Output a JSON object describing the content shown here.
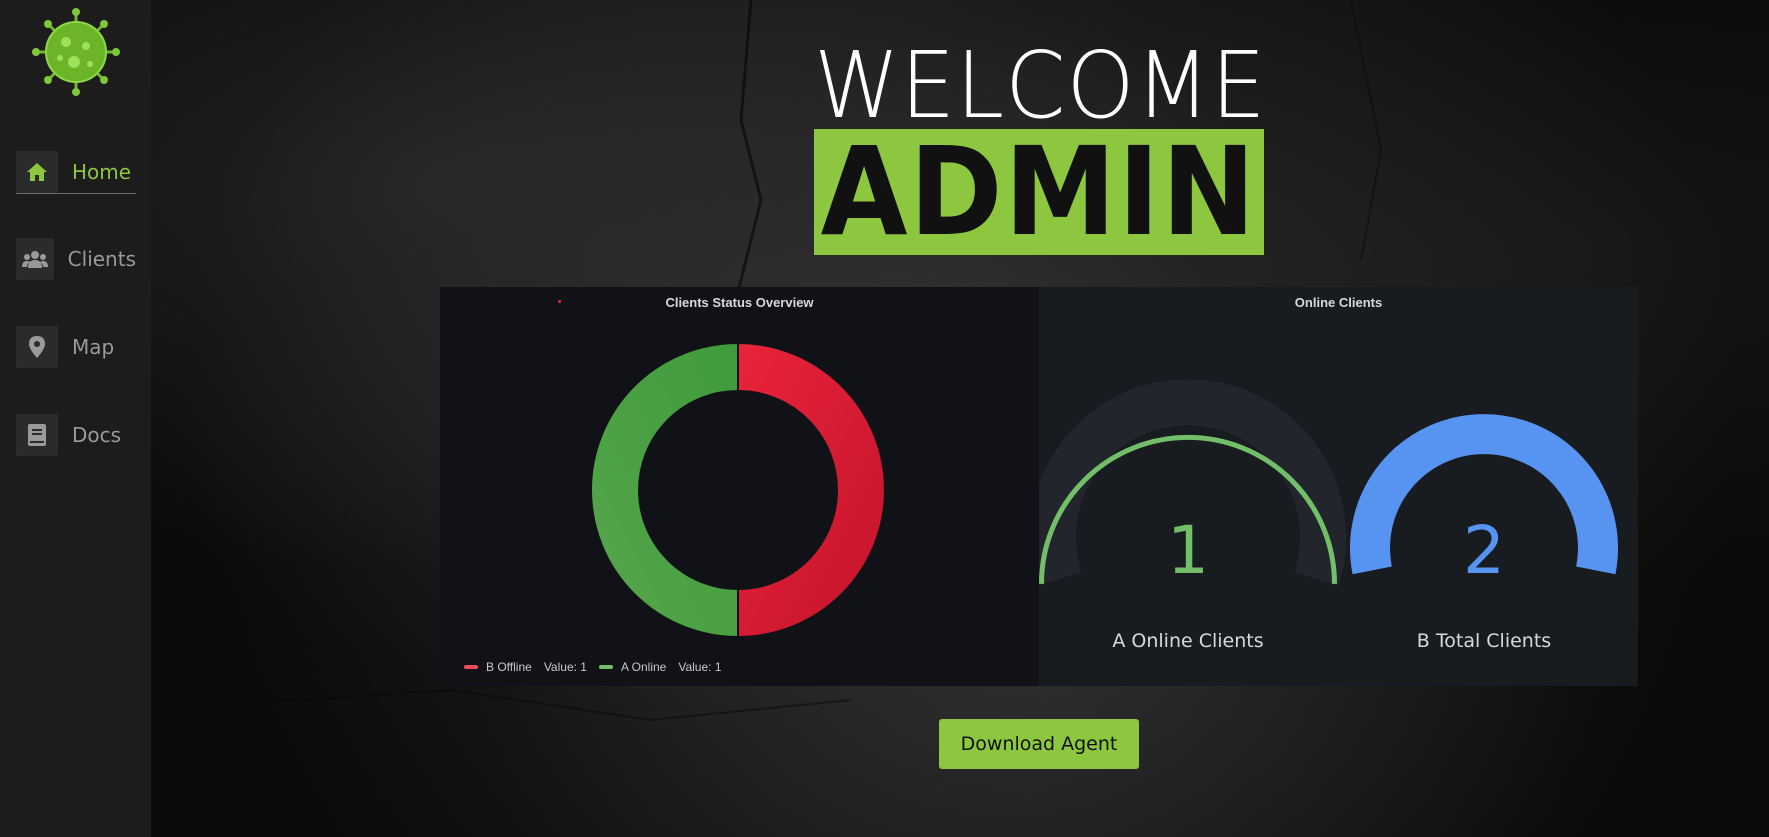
{
  "sidebar": {
    "logo_icon": "virus-icon",
    "items": [
      {
        "label": "Home",
        "icon": "home-icon",
        "active": true
      },
      {
        "label": "Clients",
        "icon": "users-icon",
        "active": false
      },
      {
        "label": "Map",
        "icon": "map-marker-icon",
        "active": false
      },
      {
        "label": "Docs",
        "icon": "book-icon",
        "active": false
      }
    ]
  },
  "header": {
    "welcome": "WELCOME",
    "admin": "ADMIN"
  },
  "status_panel": {
    "title": "Clients Status Overview",
    "chart_data": {
      "type": "pie",
      "title": "Clients Status Overview",
      "categories": [
        "B Offline",
        "A Online"
      ],
      "values": [
        1,
        1
      ],
      "colors": [
        "#e02f44",
        "#56a64b"
      ],
      "legend_placement": "bottom-left"
    },
    "legend": [
      {
        "name": "B Offline",
        "value_text": "Value: 1",
        "color": "#f2495c"
      },
      {
        "name": "A Online",
        "value_text": "Value: 1",
        "color": "#73bf69"
      }
    ]
  },
  "online_panel": {
    "title": "Online Clients",
    "gauges": [
      {
        "value": "1",
        "label": "A Online Clients",
        "color": "#73bf69"
      },
      {
        "value": "2",
        "label": "B Total Clients",
        "color": "#5794f2"
      }
    ]
  },
  "actions": {
    "download_label": "Download Agent"
  },
  "colors": {
    "accent": "#8dc63f",
    "sidebar_bg": "#1c1c1c",
    "panel_bg": "#111217"
  }
}
